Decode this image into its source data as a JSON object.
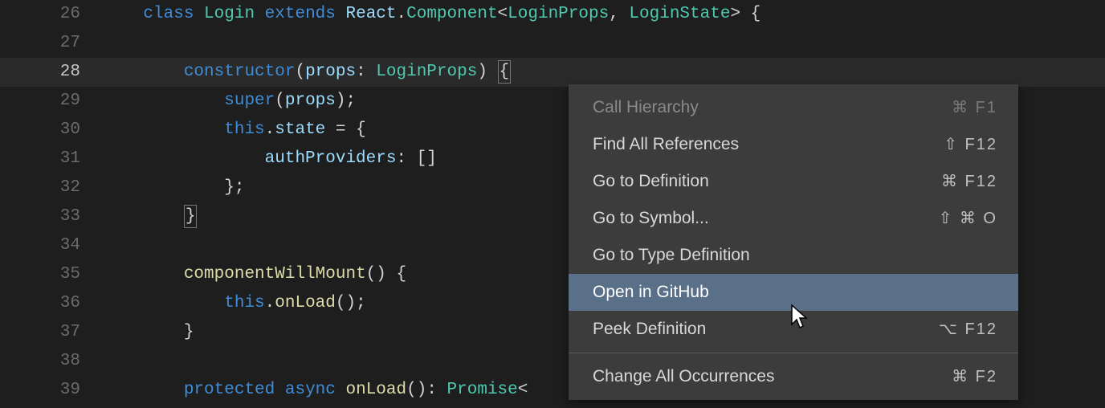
{
  "lines": [
    {
      "num": "26",
      "indent": "    ",
      "highlight": false,
      "tokens": [
        {
          "t": "class ",
          "c": "k-storage"
        },
        {
          "t": "Login ",
          "c": "k-type"
        },
        {
          "t": "extends ",
          "c": "k-storage"
        },
        {
          "t": "React",
          "c": "k-ident"
        },
        {
          "t": ".",
          "c": "k-pun"
        },
        {
          "t": "Component",
          "c": "k-type"
        },
        {
          "t": "<",
          "c": "k-pun"
        },
        {
          "t": "LoginProps",
          "c": "k-type"
        },
        {
          "t": ", ",
          "c": "k-pun"
        },
        {
          "t": "LoginState",
          "c": "k-type"
        },
        {
          "t": "> {",
          "c": "k-pun"
        }
      ]
    },
    {
      "num": "27",
      "indent": "",
      "highlight": false,
      "tokens": []
    },
    {
      "num": "28",
      "indent": "        ",
      "highlight": true,
      "tokens": [
        {
          "t": "constructor",
          "c": "k-storage"
        },
        {
          "t": "(",
          "c": "k-pun"
        },
        {
          "t": "props",
          "c": "k-ident"
        },
        {
          "t": ": ",
          "c": "k-pun"
        },
        {
          "t": "LoginProps",
          "c": "k-type"
        },
        {
          "t": ") ",
          "c": "k-pun"
        },
        {
          "t": "{",
          "c": "k-bracebox"
        }
      ]
    },
    {
      "num": "29",
      "indent": "            ",
      "highlight": false,
      "tokens": [
        {
          "t": "super",
          "c": "k-storage"
        },
        {
          "t": "(",
          "c": "k-pun"
        },
        {
          "t": "props",
          "c": "k-ident"
        },
        {
          "t": ");",
          "c": "k-pun"
        }
      ]
    },
    {
      "num": "30",
      "indent": "            ",
      "highlight": false,
      "tokens": [
        {
          "t": "this",
          "c": "k-this"
        },
        {
          "t": ".",
          "c": "k-pun"
        },
        {
          "t": "state",
          "c": "k-ident"
        },
        {
          "t": " = {",
          "c": "k-pun"
        }
      ]
    },
    {
      "num": "31",
      "indent": "                ",
      "highlight": false,
      "tokens": [
        {
          "t": "authProviders",
          "c": "k-ident"
        },
        {
          "t": ": []",
          "c": "k-pun"
        }
      ]
    },
    {
      "num": "32",
      "indent": "            ",
      "highlight": false,
      "tokens": [
        {
          "t": "};",
          "c": "k-pun"
        }
      ]
    },
    {
      "num": "33",
      "indent": "        ",
      "highlight": false,
      "tokens": [
        {
          "t": "}",
          "c": "k-bracebox"
        }
      ]
    },
    {
      "num": "34",
      "indent": "",
      "highlight": false,
      "tokens": []
    },
    {
      "num": "35",
      "indent": "        ",
      "highlight": false,
      "tokens": [
        {
          "t": "componentWillMount",
          "c": "k-fn"
        },
        {
          "t": "() {",
          "c": "k-pun"
        }
      ]
    },
    {
      "num": "36",
      "indent": "            ",
      "highlight": false,
      "tokens": [
        {
          "t": "this",
          "c": "k-this"
        },
        {
          "t": ".",
          "c": "k-pun"
        },
        {
          "t": "onLoad",
          "c": "k-fn"
        },
        {
          "t": "();",
          "c": "k-pun"
        }
      ]
    },
    {
      "num": "37",
      "indent": "        ",
      "highlight": false,
      "tokens": [
        {
          "t": "}",
          "c": "k-pun"
        }
      ]
    },
    {
      "num": "38",
      "indent": "",
      "highlight": false,
      "tokens": []
    },
    {
      "num": "39",
      "indent": "        ",
      "highlight": false,
      "tokens": [
        {
          "t": "protected ",
          "c": "k-storage"
        },
        {
          "t": "async ",
          "c": "k-storage"
        },
        {
          "t": "onLoad",
          "c": "k-fn"
        },
        {
          "t": "(): ",
          "c": "k-pun"
        },
        {
          "t": "Promise",
          "c": "k-ret"
        },
        {
          "t": "<",
          "c": "k-pun"
        }
      ]
    }
  ],
  "menu": {
    "items": [
      {
        "label": "Call Hierarchy",
        "shortcut": "⌘ F1",
        "disabled": true,
        "selected": false,
        "sepAfter": false
      },
      {
        "label": "Find All References",
        "shortcut": "⇧ F12",
        "disabled": false,
        "selected": false,
        "sepAfter": false
      },
      {
        "label": "Go to Definition",
        "shortcut": "⌘ F12",
        "disabled": false,
        "selected": false,
        "sepAfter": false
      },
      {
        "label": "Go to Symbol...",
        "shortcut": "⇧ ⌘ O",
        "disabled": false,
        "selected": false,
        "sepAfter": false
      },
      {
        "label": "Go to Type Definition",
        "shortcut": "",
        "disabled": false,
        "selected": false,
        "sepAfter": false
      },
      {
        "label": "Open in GitHub",
        "shortcut": "",
        "disabled": false,
        "selected": true,
        "sepAfter": false
      },
      {
        "label": "Peek Definition",
        "shortcut": "⌥ F12",
        "disabled": false,
        "selected": false,
        "sepAfter": true
      },
      {
        "label": "Change All Occurrences",
        "shortcut": "⌘ F2",
        "disabled": false,
        "selected": false,
        "sepAfter": false
      }
    ]
  }
}
